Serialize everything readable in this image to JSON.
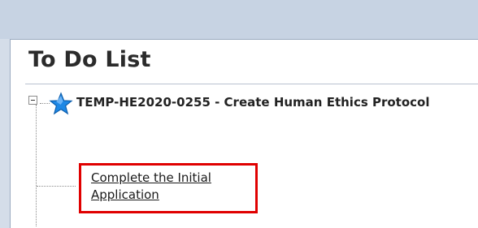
{
  "panel": {
    "title": "To Do List"
  },
  "tree": {
    "expander_icon": "minus-box-icon",
    "item": {
      "icon": "star-icon",
      "icon_color": "#1e88e5",
      "title": "TEMP-HE2020-0255 - Create Human Ethics Protocol",
      "task": {
        "label": "Complete the Initial Application",
        "highlight_color": "#e00000"
      }
    }
  }
}
